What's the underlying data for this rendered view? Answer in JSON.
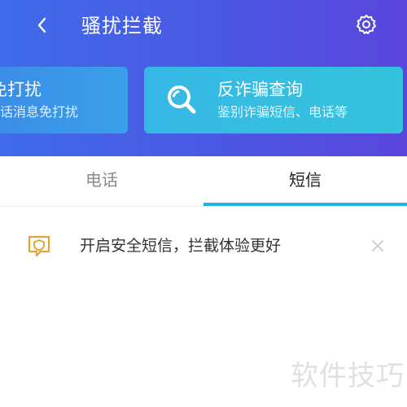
{
  "header": {
    "title": "骚扰拦截",
    "background_colors": [
      "#3f6bea",
      "#5a45dd"
    ]
  },
  "cards": [
    {
      "title": "免打扰",
      "subtitle": "电话消息免打扰"
    },
    {
      "title": "反诈骗查询",
      "subtitle": "鉴别诈骗短信、电话等",
      "icon": "search-icon"
    }
  ],
  "tabs": [
    {
      "label": "电话",
      "active": false
    },
    {
      "label": "短信",
      "active": true
    }
  ],
  "accent_color": "#2bb0e6",
  "notice": {
    "text": "开启安全短信，拦截体验更好",
    "icon": "shield-message-icon",
    "icon_color": "#e0a43a"
  },
  "watermark": "软件技巧"
}
